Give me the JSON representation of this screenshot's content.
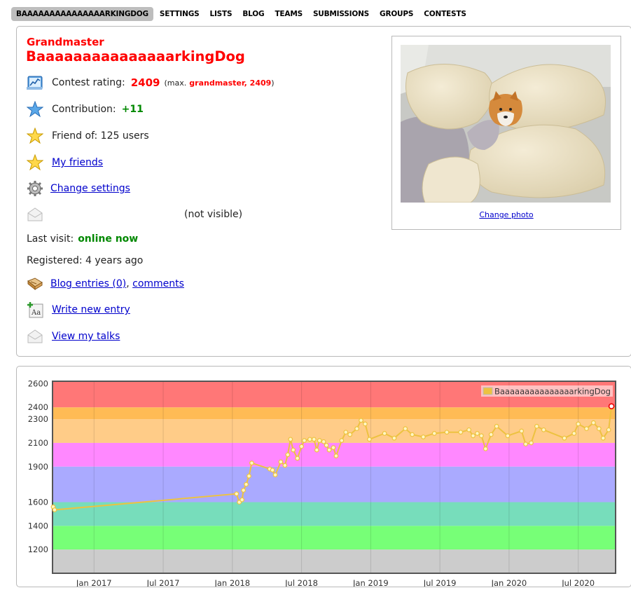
{
  "nav": [
    "BAAAAAAAAAAAAAAARKINGDOG",
    "SETTINGS",
    "LISTS",
    "BLOG",
    "TEAMS",
    "SUBMISSIONS",
    "GROUPS",
    "CONTESTS"
  ],
  "profile": {
    "rank": "Grandmaster",
    "handle": "BaaaaaaaaaaaaaaarkingDog",
    "rating_label": "Contest rating:",
    "rating": "2409",
    "max_prefix": "(max.",
    "max_rank": "grandmaster, 2409",
    "max_suffix": ")",
    "contribution_label": "Contribution:",
    "contribution": "+11",
    "friend_of": "Friend of: 125 users",
    "my_friends": "My friends",
    "change_settings": "Change settings",
    "email": "(not visible)",
    "last_visit_label": "Last visit:",
    "last_visit": "online now",
    "registered": "Registered: 4 years ago",
    "blog_entries": "Blog entries (0)",
    "comments": "comments",
    "write_entry": "Write new entry",
    "view_talks": "View my talks",
    "change_photo": "Change photo"
  },
  "colors": {
    "rank_red": "#ff0000",
    "link": "#0000cc",
    "green": "#008800",
    "line": "#edc240"
  },
  "chart_data": {
    "type": "line",
    "y_ticks": [
      1200,
      1400,
      1600,
      1900,
      2100,
      2300,
      2400,
      2600
    ],
    "x_ticks": [
      "Jan 2017",
      "Jul 2017",
      "Jan 2018",
      "Jul 2018",
      "Jan 2019",
      "Jul 2019",
      "Jan 2020",
      "Jul 2020"
    ],
    "x_tick_pos": [
      0.0,
      0.5,
      1.0,
      1.5,
      2.0,
      2.5,
      3.0,
      3.5
    ],
    "xlim": [
      -0.3,
      3.77
    ],
    "ylim": [
      1000,
      2620
    ],
    "bands": [
      {
        "from": 1000,
        "to": 1200,
        "color": "#cccccc"
      },
      {
        "from": 1200,
        "to": 1400,
        "color": "#77ff77"
      },
      {
        "from": 1400,
        "to": 1600,
        "color": "#77ddbb"
      },
      {
        "from": 1600,
        "to": 1900,
        "color": "#aaaaff"
      },
      {
        "from": 1900,
        "to": 2100,
        "color": "#ff88ff"
      },
      {
        "from": 2100,
        "to": 2300,
        "color": "#ffcc88"
      },
      {
        "from": 2300,
        "to": 2400,
        "color": "#ffbb55"
      },
      {
        "from": 2400,
        "to": 2620,
        "color": "#ff7777"
      }
    ],
    "legend": "BaaaaaaaaaaaaaaarkingDog",
    "series": [
      {
        "name": "BaaaaaaaaaaaaaaarkingDog",
        "x": [
          -0.295,
          -0.285,
          1.03,
          1.05,
          1.07,
          1.08,
          1.1,
          1.12,
          1.14,
          1.27,
          1.29,
          1.31,
          1.35,
          1.38,
          1.4,
          1.42,
          1.44,
          1.47,
          1.5,
          1.52,
          1.56,
          1.59,
          1.61,
          1.63,
          1.66,
          1.68,
          1.7,
          1.73,
          1.75,
          1.79,
          1.82,
          1.85,
          1.9,
          1.93,
          1.96,
          1.99,
          2.1,
          2.17,
          2.25,
          2.3,
          2.38,
          2.46,
          2.55,
          2.65,
          2.71,
          2.74,
          2.77,
          2.8,
          2.83,
          2.87,
          2.91,
          2.99,
          3.09,
          3.12,
          3.16,
          3.2,
          3.25,
          3.4,
          3.47,
          3.5,
          3.56,
          3.61,
          3.65,
          3.68,
          3.72,
          3.74
        ],
        "y": [
          1560,
          1535,
          1670,
          1600,
          1620,
          1700,
          1750,
          1820,
          1930,
          1880,
          1870,
          1830,
          1940,
          1910,
          2000,
          2130,
          2040,
          1970,
          2070,
          2120,
          2130,
          2130,
          2040,
          2120,
          2110,
          2080,
          2040,
          2060,
          1990,
          2120,
          2190,
          2170,
          2220,
          2290,
          2260,
          2130,
          2180,
          2140,
          2220,
          2170,
          2150,
          2180,
          2190,
          2190,
          2210,
          2160,
          2180,
          2160,
          2050,
          2170,
          2240,
          2160,
          2200,
          2090,
          2100,
          2240,
          2210,
          2140,
          2180,
          2260,
          2220,
          2270,
          2220,
          2140,
          2210,
          2409
        ]
      }
    ]
  }
}
